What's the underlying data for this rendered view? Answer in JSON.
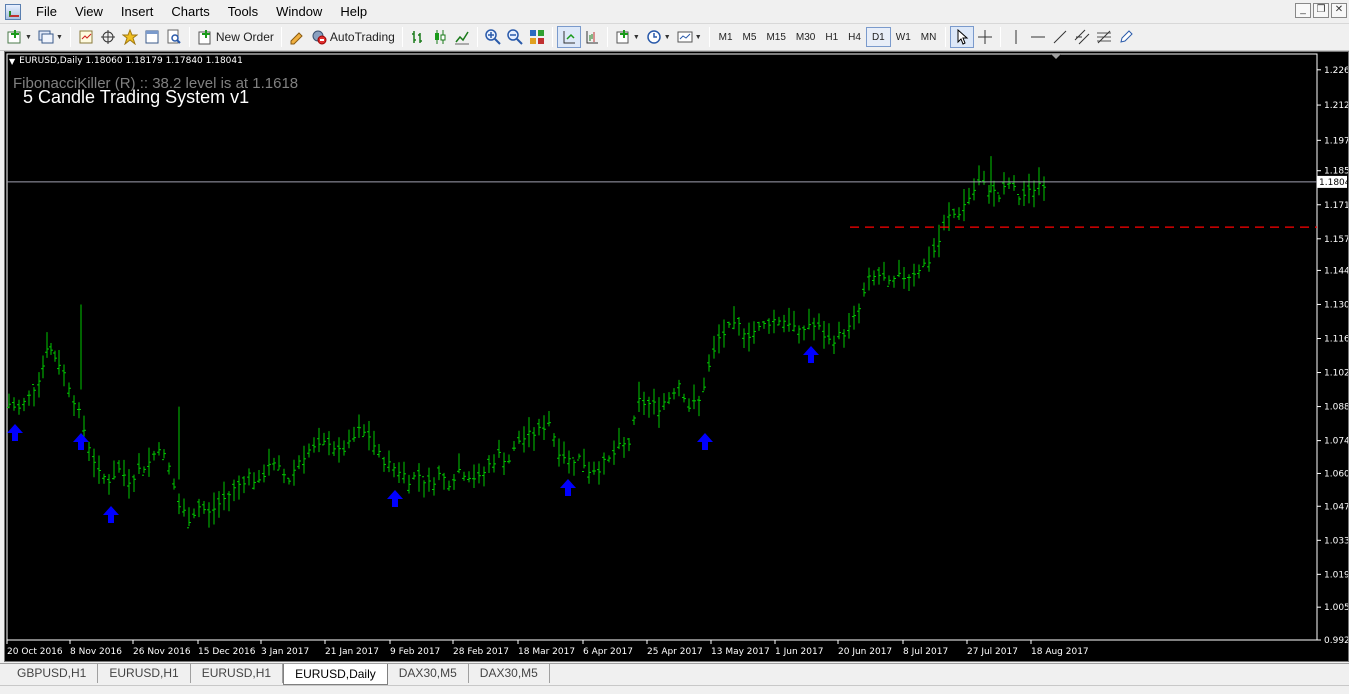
{
  "menu": {
    "items": [
      "File",
      "View",
      "Insert",
      "Charts",
      "Tools",
      "Window",
      "Help"
    ]
  },
  "window_controls": {
    "minimize": "_",
    "restore": "❐",
    "close": "✕"
  },
  "toolbar": {
    "new_order_label": "New Order",
    "autotrading_label": "AutoTrading",
    "timeframes": [
      "M1",
      "M5",
      "M15",
      "M30",
      "H1",
      "H4",
      "D1",
      "W1",
      "MN"
    ],
    "active_timeframe": "D1"
  },
  "chart": {
    "symbol_info": "EURUSD,Daily  1.18060 1.18179 1.17840 1.18041",
    "indicator_text": "FibonacciKiller (R) :: 38.2 level is at 1.1618",
    "system_title": "5 Candle Trading System v1",
    "current_price": "1.1804",
    "fib_level": 1.1618,
    "price_labels": [
      "1.2265",
      "1.2120",
      "1.1975",
      "1.1850",
      "1.1710",
      "1.1570",
      "1.1440",
      "1.1300",
      "1.1160",
      "1.1020",
      "1.0880",
      "1.0740",
      "1.0605",
      "1.0470",
      "1.0330",
      "1.0190",
      "1.0055",
      "0.9920"
    ],
    "date_labels": [
      "20 Oct 2016",
      "8 Nov 2016",
      "26 Nov 2016",
      "15 Dec 2016",
      "3 Jan 2017",
      "21 Jan 2017",
      "9 Feb 2017",
      "28 Feb 2017",
      "18 Mar 2017",
      "6 Apr 2017",
      "25 Apr 2017",
      "13 May 2017",
      "1 Jun 2017",
      "20 Jun 2017",
      "8 Jul 2017",
      "27 Jul 2017",
      "18 Aug 2017"
    ],
    "colors": {
      "background": "#000000",
      "bars": "#00c800",
      "fib_line": "#ff0000",
      "price_line": "#a0a0b0",
      "arrows": "#0000ff"
    }
  },
  "chart_data": {
    "type": "line",
    "title": "EURUSD,Daily",
    "ylim": [
      0.992,
      1.233
    ],
    "x": [
      0,
      10,
      20,
      30,
      34,
      38,
      42,
      50,
      60,
      70,
      80,
      90,
      100,
      110,
      120,
      130,
      140,
      150,
      160,
      170,
      180,
      190,
      200,
      210,
      220,
      230,
      240,
      250,
      260,
      270,
      280,
      290,
      300,
      310,
      320,
      330,
      340,
      350,
      360,
      370,
      380,
      390,
      400,
      410,
      420,
      430,
      440,
      450,
      460,
      470,
      480,
      490,
      500,
      510,
      520,
      530,
      540,
      550,
      560,
      570,
      580,
      590,
      600,
      610,
      620,
      630,
      640,
      650,
      660,
      670,
      680,
      690,
      700,
      710,
      720,
      730,
      740,
      750,
      760,
      770,
      780,
      790,
      800,
      810,
      820,
      830,
      840,
      850,
      860,
      870,
      880,
      890,
      900,
      910,
      920,
      930,
      940,
      950,
      960,
      970,
      980,
      990,
      1000,
      1010,
      1020,
      1030,
      1040
    ],
    "series": [
      {
        "values": [
          1.089,
          1.087,
          1.092,
          1.1,
          1.105,
          1.113,
          1.111,
          1.106,
          1.097,
          1.085,
          1.072,
          1.06,
          1.058,
          1.062,
          1.058,
          1.062,
          1.065,
          1.072,
          1.063,
          1.047,
          1.042,
          1.047,
          1.044,
          1.048,
          1.052,
          1.056,
          1.06,
          1.056,
          1.065,
          1.062,
          1.058,
          1.066,
          1.07,
          1.071,
          1.074,
          1.069,
          1.072,
          1.078,
          1.076,
          1.068,
          1.064,
          1.062,
          1.058,
          1.06,
          1.056,
          1.06,
          1.057,
          1.062,
          1.06,
          1.058,
          1.064,
          1.068,
          1.066,
          1.074,
          1.076,
          1.078,
          1.082,
          1.07,
          1.066,
          1.067,
          1.062,
          1.063,
          1.066,
          1.071,
          1.073,
          1.09,
          1.089,
          1.088,
          1.092,
          1.098,
          1.088,
          1.09,
          1.104,
          1.116,
          1.12,
          1.121,
          1.118,
          1.12,
          1.123,
          1.124,
          1.123,
          1.118,
          1.122,
          1.12,
          1.115,
          1.117,
          1.12,
          1.128,
          1.14,
          1.142,
          1.138,
          1.141,
          1.142,
          1.145,
          1.148,
          1.156,
          1.166,
          1.168,
          1.174,
          1.18,
          1.178,
          1.174,
          1.18,
          1.174,
          1.176,
          1.18,
          1.1804
        ]
      }
    ],
    "signal_arrows_x": [
      8,
      74,
      104,
      388,
      561,
      698,
      804
    ],
    "horizontal_lines": [
      {
        "value": 1.1804,
        "label": "current price"
      },
      {
        "value": 1.1618,
        "label": "38.2 level"
      }
    ]
  },
  "tabs": {
    "items": [
      "GBPUSD,H1",
      "EURUSD,H1",
      "EURUSD,H1",
      "EURUSD,Daily",
      "DAX30,M5",
      "DAX30,M5"
    ],
    "active_index": 3
  }
}
